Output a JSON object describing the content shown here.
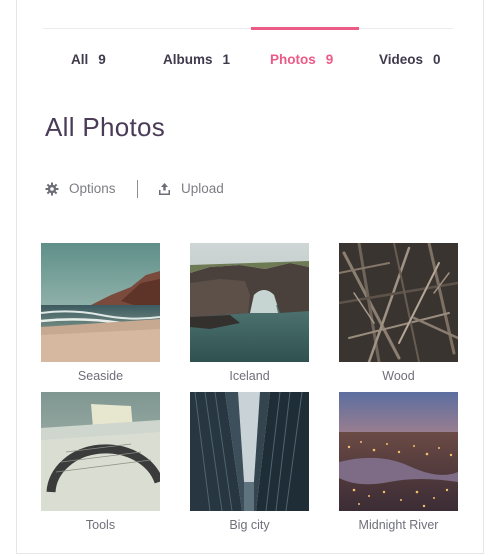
{
  "tabs": [
    {
      "label": "All",
      "count": "9"
    },
    {
      "label": "Albums",
      "count": "1"
    },
    {
      "label": "Photos",
      "count": "9"
    },
    {
      "label": "Videos",
      "count": "0"
    }
  ],
  "active_tab_color": "#ec5a86",
  "page_title": "All Photos",
  "toolbar": {
    "options_label": "Options",
    "upload_label": "Upload"
  },
  "photos": [
    {
      "caption": "Seaside"
    },
    {
      "caption": "Iceland"
    },
    {
      "caption": "Wood"
    },
    {
      "caption": "Tools"
    },
    {
      "caption": "Big city"
    },
    {
      "caption": "Midnight River"
    }
  ]
}
